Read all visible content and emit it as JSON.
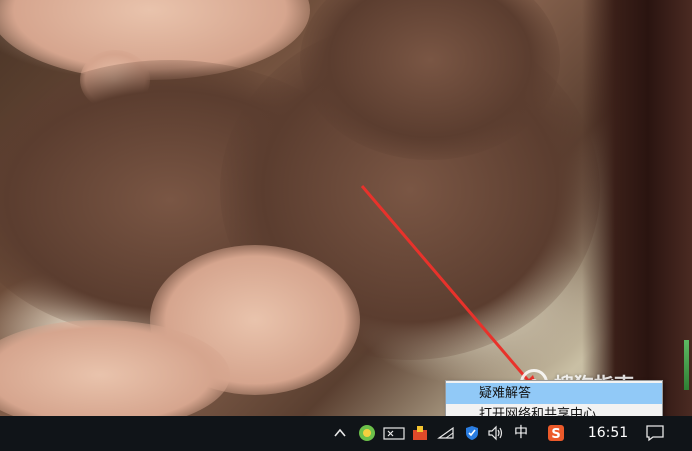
{
  "context_menu": {
    "items": [
      {
        "label": "疑难解答",
        "highlighted": true
      },
      {
        "label": "打开网络和共享中心",
        "highlighted": false
      }
    ]
  },
  "watermark": {
    "text": "搜狗指南"
  },
  "taskbar": {
    "clock": "16:51",
    "ime_label": "中",
    "tray_icons": [
      "chevron-up-icon",
      "green-status-icon",
      "card-reader-icon",
      "antivirus-icon",
      "wifi-icon",
      "shield-icon",
      "volume-icon",
      "ime-icon",
      "sogou-input-icon",
      "notification-icon"
    ]
  },
  "colors": {
    "menu_highlight": "#91c9f7",
    "taskbar": "#101418",
    "arrow": "#e8322b"
  }
}
